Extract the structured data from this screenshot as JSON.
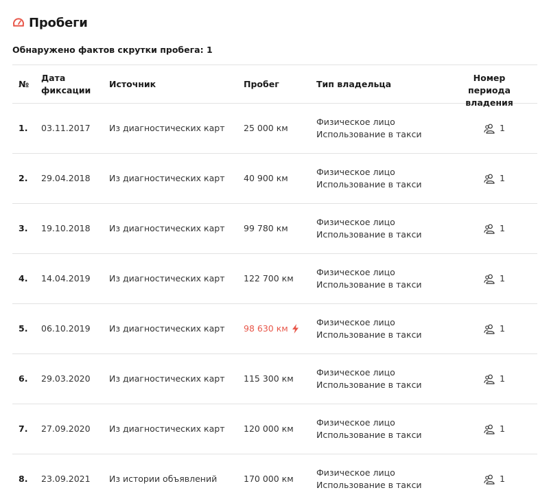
{
  "header": {
    "title": "Пробеги",
    "subtitle": "Обнаружено фактов скрутки пробега: 1",
    "accent_color": "#e8574a"
  },
  "table": {
    "columns": {
      "num": "№",
      "date_line1": "Дата",
      "date_line2": "фиксации",
      "source": "Источник",
      "mileage": "Пробег",
      "owner_type": "Тип владельца",
      "period_line1": "Номер периода",
      "period_line2": "владения"
    },
    "rows": [
      {
        "num": "1.",
        "date": "03.11.2017",
        "source": "Из диагностических карт",
        "mileage": "25 000 км",
        "owner_line1": "Физическое лицо",
        "owner_line2": "Использование в такси",
        "period": "1",
        "alert": false
      },
      {
        "num": "2.",
        "date": "29.04.2018",
        "source": "Из диагностических карт",
        "mileage": "40 900 км",
        "owner_line1": "Физическое лицо",
        "owner_line2": "Использование в такси",
        "period": "1",
        "alert": false
      },
      {
        "num": "3.",
        "date": "19.10.2018",
        "source": "Из диагностических карт",
        "mileage": "99 780 км",
        "owner_line1": "Физическое лицо",
        "owner_line2": "Использование в такси",
        "period": "1",
        "alert": false
      },
      {
        "num": "4.",
        "date": "14.04.2019",
        "source": "Из диагностических карт",
        "mileage": "122 700 км",
        "owner_line1": "Физическое лицо",
        "owner_line2": "Использование в такси",
        "period": "1",
        "alert": false
      },
      {
        "num": "5.",
        "date": "06.10.2019",
        "source": "Из диагностических карт",
        "mileage": "98 630 км",
        "owner_line1": "Физическое лицо",
        "owner_line2": "Использование в такси",
        "period": "1",
        "alert": true
      },
      {
        "num": "6.",
        "date": "29.03.2020",
        "source": "Из диагностических карт",
        "mileage": "115 300 км",
        "owner_line1": "Физическое лицо",
        "owner_line2": "Использование в такси",
        "period": "1",
        "alert": false
      },
      {
        "num": "7.",
        "date": "27.09.2020",
        "source": "Из диагностических карт",
        "mileage": "120 000 км",
        "owner_line1": "Физическое лицо",
        "owner_line2": "Использование в такси",
        "period": "1",
        "alert": false
      },
      {
        "num": "8.",
        "date": "23.09.2021",
        "source": "Из истории объявлений",
        "mileage": "170 000 км",
        "owner_line1": "Физическое лицо",
        "owner_line2": "Использование в такси",
        "period": "1",
        "alert": false
      }
    ]
  },
  "icons": {
    "title": "speedometer-icon",
    "alert": "lightning-bolt-icon",
    "period": "owners-icon"
  }
}
